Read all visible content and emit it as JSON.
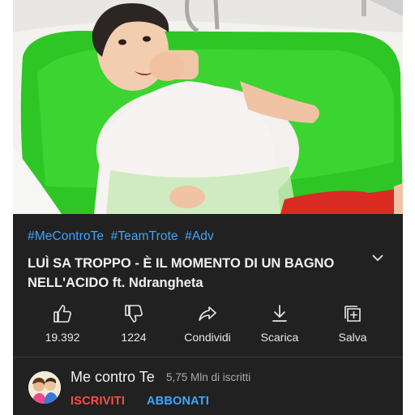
{
  "video": {
    "hashtags": [
      "#MeControTe",
      "#TeamTrote",
      "#Adv"
    ],
    "title": "LUÌ SA TROPPO - È IL MOMENTO DI UN BAGNO NELL'ACIDO ft. Ndrangheta"
  },
  "actions": {
    "like_count": "19.392",
    "dislike_count": "1224",
    "share_label": "Condividi",
    "download_label": "Scarica",
    "save_label": "Salva"
  },
  "channel": {
    "name": "Me contro Te",
    "subscribers": "5,75 Mln di iscritti",
    "subscribe_label": "ISCRIVITI",
    "join_label": "ABBONATI"
  },
  "colors": {
    "background": "#212121",
    "link_blue": "#3ea6ff",
    "subscribe_red": "#ff4e45",
    "slime_green": "#33d62b"
  }
}
